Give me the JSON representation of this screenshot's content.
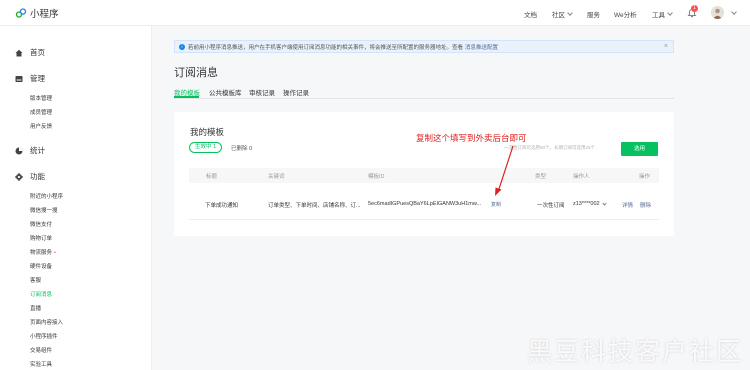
{
  "app": {
    "title": "小程序"
  },
  "topnav": {
    "docs": "文档",
    "community": "社区",
    "service": "服务",
    "we_analytics": "We分析",
    "tools": "工具",
    "notification_count": "1"
  },
  "sidebar": {
    "home": "首页",
    "manage": "管理",
    "manage_items": [
      "版本管理",
      "成员管理",
      "用户反馈"
    ],
    "stats": "统计",
    "features": "功能",
    "feature_items": [
      "附近的小程序",
      "微信搜一搜",
      "微信支付",
      "购物订单",
      "物流服务",
      "硬件设备",
      "客服",
      "订阅消息",
      "直播",
      "页面内容接入",
      "小程序插件",
      "交易组件",
      "实验工具"
    ],
    "logistics_dot": "•",
    "active_item": "订阅消息"
  },
  "notice": {
    "text": "若前用小程序消息推送，用户在手机客户端使用订阅消息功能的相关事件，将会推送至所配置的服务器地址。查看",
    "link": "消息推送配置",
    "close": "×"
  },
  "page": {
    "title": "订阅消息",
    "tabs": [
      "我的模板",
      "公共模板库",
      "审核记录",
      "操作记录"
    ]
  },
  "card": {
    "title": "我的模板",
    "status_pill": "生效中 1",
    "deleted": "已删除 0",
    "limit_text": "一次性订阅可选用50个，长期订阅可选用25个",
    "select_button": "选用"
  },
  "table": {
    "headers": [
      "标题",
      "关键词",
      "模板ID",
      "类型",
      "操作人",
      "操作"
    ],
    "rows": [
      {
        "title": "下单成功通知",
        "keywords": "订单类型、下单时间、店铺名称、订...",
        "template_id": "5ec6madIGPuesQBaY6LpEIGANW3uH1mw...",
        "copy": "复制",
        "type": "一次性订阅",
        "operator": "z13****002",
        "detail": "详情",
        "delete": "删除"
      }
    ]
  },
  "annotation": {
    "text": "复制这个填写到外卖后台即可",
    "color": "#e02020"
  },
  "watermark": "黑豆科技客户社区",
  "colors": {
    "accent": "#07c160",
    "link": "#576b95",
    "danger": "#fa5151"
  }
}
